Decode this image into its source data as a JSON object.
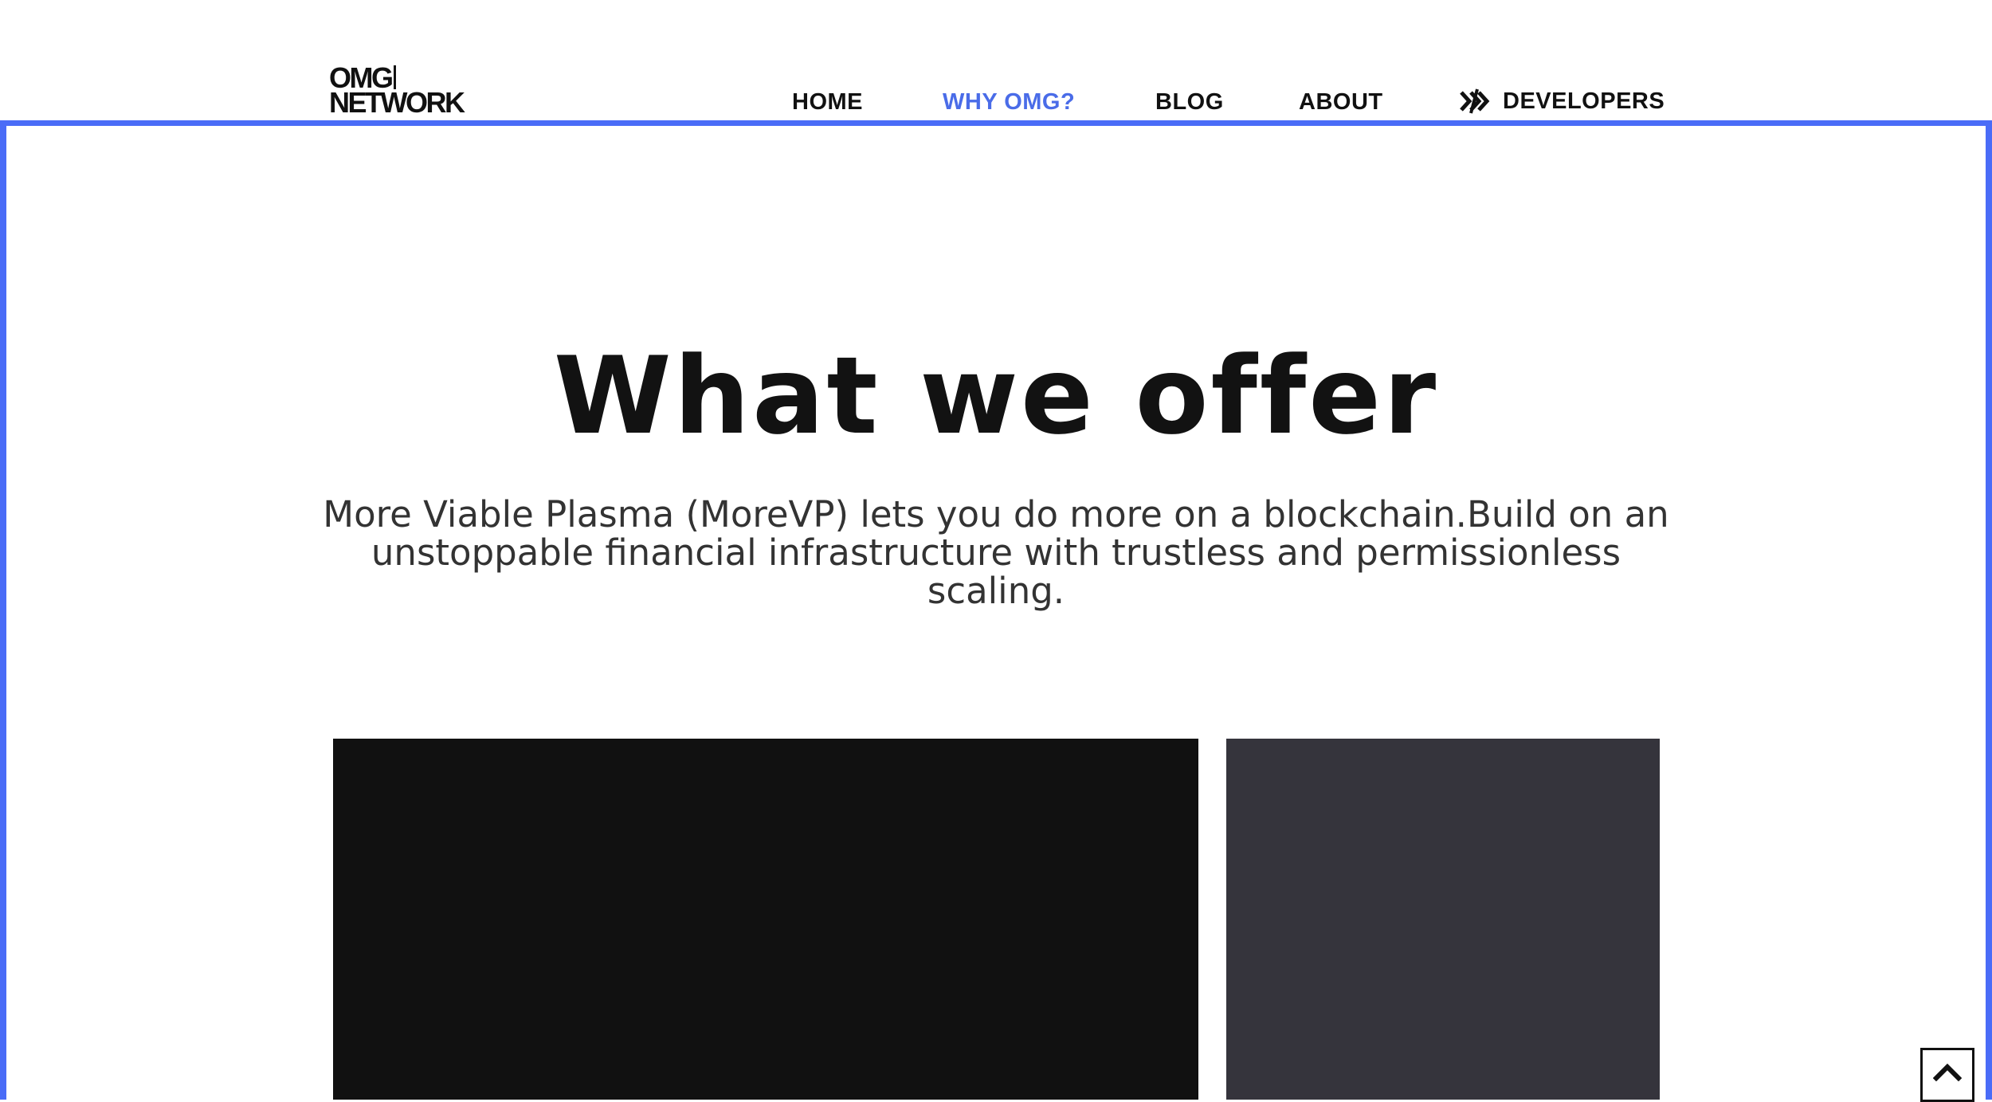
{
  "brand": {
    "logo_line1": "OMG",
    "logo_line2": "NETWORK"
  },
  "nav": {
    "items": [
      {
        "label": "HOME"
      },
      {
        "label": "WHY OMG?"
      },
      {
        "label": "BLOG"
      },
      {
        "label": "ABOUT"
      },
      {
        "label": "DEVELOPERS",
        "icon": "developer-arrows-icon"
      }
    ],
    "active": "WHY OMG?"
  },
  "hero": {
    "title": "What we offer",
    "description": "More Viable Plasma (MoreVP) lets you do more on a blockchain.Build on an unstoppable financial infrastructure with trustless and permissionless scaling."
  },
  "cards": [
    {
      "name": "dark-card",
      "color": "#111111"
    },
    {
      "name": "gray-card",
      "color": "#35343c"
    }
  ],
  "scroll_top": {
    "icon": "chevron-up-icon"
  },
  "colors": {
    "accent": "#4a6cf7",
    "active_link": "#4a6ce8",
    "text": "#111111"
  }
}
